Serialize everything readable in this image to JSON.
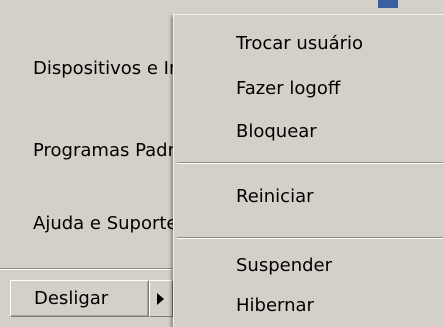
{
  "start_panel": {
    "items": [
      {
        "label": "Dispositivos e Impressoras"
      },
      {
        "label": "Programas Padrão"
      },
      {
        "label": "Ajuda e Suporte"
      }
    ],
    "shutdown_label": "Desligar"
  },
  "shutdown_menu": {
    "items": [
      {
        "label": "Trocar usuário"
      },
      {
        "label": "Fazer logoff"
      },
      {
        "label": "Bloquear"
      },
      {
        "label": "Reiniciar"
      },
      {
        "label": "Suspender"
      },
      {
        "label": "Hibernar"
      }
    ]
  },
  "icons": {
    "arrow": "chevron-right-icon"
  }
}
